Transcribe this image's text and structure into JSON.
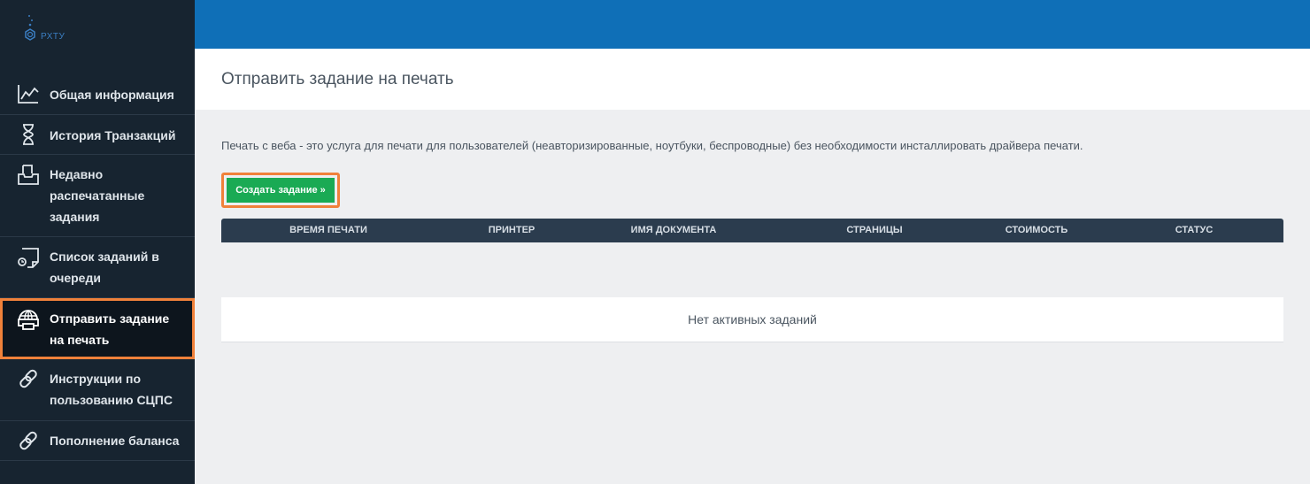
{
  "logo": {
    "text": "РХТУ"
  },
  "sidebar": {
    "items": [
      {
        "lines": [
          "Общая информация"
        ],
        "icon": "chart-line-icon"
      },
      {
        "lines": [
          "История Транзакций"
        ],
        "icon": "hourglass-icon"
      },
      {
        "lines": [
          "Недавно",
          "распечатанные",
          "задания"
        ],
        "icon": "tray-icon"
      },
      {
        "lines": [
          "Список заданий в",
          "очереди"
        ],
        "icon": "queue-page-icon"
      },
      {
        "lines": [
          "Отправить задание",
          "на печать"
        ],
        "icon": "globe-printer-icon"
      },
      {
        "lines": [
          "Инструкции по",
          "пользованию СЦПС"
        ],
        "icon": "link-icon"
      },
      {
        "lines": [
          "Пополнение баланса"
        ],
        "icon": "link-icon"
      }
    ],
    "active_index": 4
  },
  "page": {
    "title": "Отправить задание на печать"
  },
  "description": "Печать с веба - это услуга для печати для пользователей (неавторизированные, ноутбуки, беспроводные) без необходимости инсталлировать драйвера печати.",
  "create_button": {
    "label": "Создать задание »"
  },
  "table": {
    "columns": [
      "ВРЕМЯ ПЕЧАТИ",
      "ПРИНТЕР",
      "ИМЯ ДОКУМЕНТА",
      "СТРАНИЦЫ",
      "СТОИМОСТЬ",
      "СТАТУС"
    ],
    "empty_text": "Нет активных заданий"
  },
  "colors": {
    "sidebar_bg": "#172430",
    "topbar": "#0f6fb7",
    "highlight": "#f0813a",
    "button_green": "#1aaa54",
    "table_header": "#2b3c4e"
  }
}
